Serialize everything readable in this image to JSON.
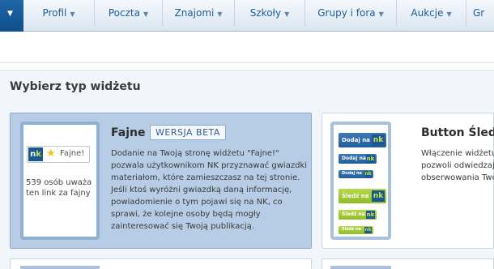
{
  "nav": {
    "items": [
      {
        "label": "Profil"
      },
      {
        "label": "Poczta"
      },
      {
        "label": "Znajomi"
      },
      {
        "label": "Szkoły"
      },
      {
        "label": "Grupy i fora"
      },
      {
        "label": "Aukcje"
      },
      {
        "label": "Gr"
      }
    ]
  },
  "panel": {
    "title": "Wybierz typ widżetu"
  },
  "widgets": [
    {
      "title": "Fajne",
      "badge": "WERSJA BETA",
      "preview": {
        "button_label": "Fajne!",
        "likes_text": "539 osób uważa ten link za fajny"
      },
      "description": "Dodanie na Twoją stronę widżetu \"Fajne!\" pozwala użytkownikom NK przyznawać gwiazdki materiałom, które zamieszczasz na tej stronie. Jeśli ktoś wyróżni gwiazdką daną informację, powiadomienie o tym pojawi się na NK, co sprawi, że kolejne osoby będą mogły zainteresować się Twoją publikacją."
    },
    {
      "title": "Button Śledź",
      "preview": {
        "blue_label": "Dodaj na",
        "green_label": "Śledź na",
        "nk": "nk"
      },
      "description_lines": [
        "Włączenie widżetu",
        "pozwoli odwiedzają",
        "obserwowania Twoj"
      ]
    }
  ],
  "colors": {
    "nav_text": "#1e5c95",
    "selected_card": "#b7cde6",
    "nk_blue": "#1a5793",
    "nk_green": "#cfe441"
  }
}
